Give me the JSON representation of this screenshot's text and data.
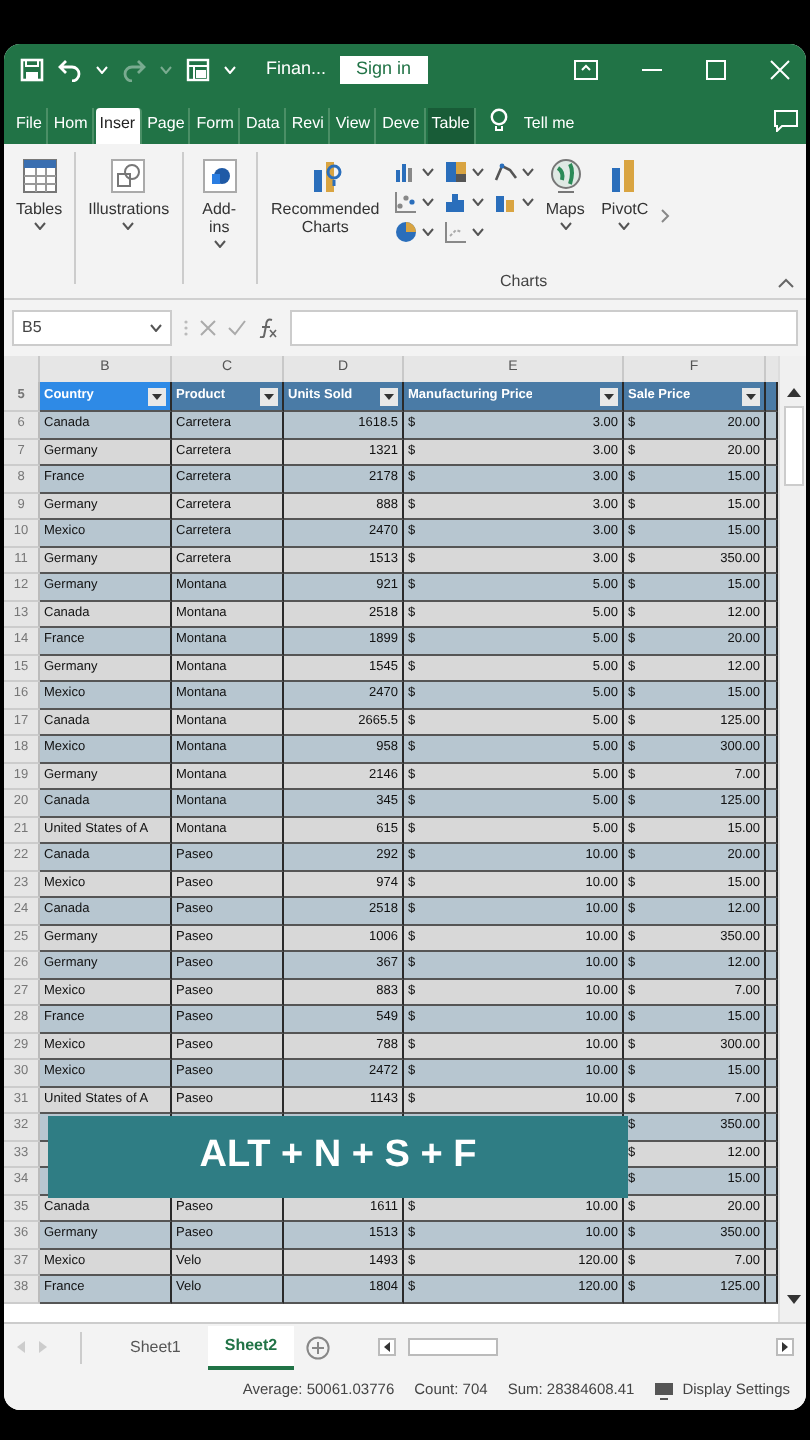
{
  "title_bar": {
    "quick_access": [
      {
        "kind": "save",
        "disabled": false
      },
      {
        "kind": "undo",
        "disabled": false
      },
      {
        "kind": "redo",
        "disabled": true
      },
      {
        "kind": "form",
        "disabled": false
      },
      {
        "kind": "customize",
        "disabled": false
      }
    ],
    "file_name": "Finan...",
    "sign_in": "Sign in"
  },
  "ribbon_tabs": [
    {
      "label": "File",
      "selected": false,
      "contextual": false
    },
    {
      "label": "Hom",
      "selected": false,
      "contextual": false
    },
    {
      "label": "Inser",
      "selected": true,
      "contextual": false
    },
    {
      "label": "Page",
      "selected": false,
      "contextual": false
    },
    {
      "label": "Form",
      "selected": false,
      "contextual": false
    },
    {
      "label": "Data",
      "selected": false,
      "contextual": false
    },
    {
      "label": "Revi",
      "selected": false,
      "contextual": false
    },
    {
      "label": "View",
      "selected": false,
      "contextual": false
    },
    {
      "label": "Deve",
      "selected": false,
      "contextual": false
    },
    {
      "label": "Table",
      "selected": false,
      "contextual": true
    }
  ],
  "tell_me": "Tell me",
  "ribbon": {
    "buttons": [
      {
        "kind": "tables",
        "label": "Tables"
      },
      {
        "kind": "illustrations",
        "label": "Illustrations"
      },
      {
        "kind": "addins",
        "label": "Add-ins"
      },
      {
        "kind": "recommended",
        "label": "Recommended Charts"
      },
      {
        "kind": "chart_grid"
      },
      {
        "kind": "maps",
        "label": "Maps"
      },
      {
        "kind": "pivot",
        "label": "PivotC"
      }
    ],
    "group_label": "Charts"
  },
  "formula_bar": {
    "name_box": "B5"
  },
  "column_letters": [
    "B",
    "C",
    "D",
    "E",
    "F"
  ],
  "header_row": "5",
  "columns": [
    {
      "header": "Country",
      "selected": true
    },
    {
      "header": "Product",
      "selected": false
    },
    {
      "header": "Units Sold",
      "selected": false
    },
    {
      "header": "Manufacturing Price",
      "selected": false
    },
    {
      "header": "Sale Price",
      "selected": false
    }
  ],
  "rows": [
    {
      "row": "6",
      "country": "Canada",
      "product": "Carretera",
      "units_sold": "1618.5",
      "mfg_currency": "$",
      "mfg_price": "3.00",
      "sale_currency": "$",
      "sale_price": "20.00"
    },
    {
      "row": "7",
      "country": "Germany",
      "product": "Carretera",
      "units_sold": "1321",
      "mfg_currency": "$",
      "mfg_price": "3.00",
      "sale_currency": "$",
      "sale_price": "20.00"
    },
    {
      "row": "8",
      "country": "France",
      "product": "Carretera",
      "units_sold": "2178",
      "mfg_currency": "$",
      "mfg_price": "3.00",
      "sale_currency": "$",
      "sale_price": "15.00"
    },
    {
      "row": "9",
      "country": "Germany",
      "product": "Carretera",
      "units_sold": "888",
      "mfg_currency": "$",
      "mfg_price": "3.00",
      "sale_currency": "$",
      "sale_price": "15.00"
    },
    {
      "row": "10",
      "country": "Mexico",
      "product": "Carretera",
      "units_sold": "2470",
      "mfg_currency": "$",
      "mfg_price": "3.00",
      "sale_currency": "$",
      "sale_price": "15.00"
    },
    {
      "row": "11",
      "country": "Germany",
      "product": "Carretera",
      "units_sold": "1513",
      "mfg_currency": "$",
      "mfg_price": "3.00",
      "sale_currency": "$",
      "sale_price": "350.00"
    },
    {
      "row": "12",
      "country": "Germany",
      "product": "Montana",
      "units_sold": "921",
      "mfg_currency": "$",
      "mfg_price": "5.00",
      "sale_currency": "$",
      "sale_price": "15.00"
    },
    {
      "row": "13",
      "country": "Canada",
      "product": "Montana",
      "units_sold": "2518",
      "mfg_currency": "$",
      "mfg_price": "5.00",
      "sale_currency": "$",
      "sale_price": "12.00"
    },
    {
      "row": "14",
      "country": "France",
      "product": "Montana",
      "units_sold": "1899",
      "mfg_currency": "$",
      "mfg_price": "5.00",
      "sale_currency": "$",
      "sale_price": "20.00"
    },
    {
      "row": "15",
      "country": "Germany",
      "product": "Montana",
      "units_sold": "1545",
      "mfg_currency": "$",
      "mfg_price": "5.00",
      "sale_currency": "$",
      "sale_price": "12.00"
    },
    {
      "row": "16",
      "country": "Mexico",
      "product": "Montana",
      "units_sold": "2470",
      "mfg_currency": "$",
      "mfg_price": "5.00",
      "sale_currency": "$",
      "sale_price": "15.00"
    },
    {
      "row": "17",
      "country": "Canada",
      "product": "Montana",
      "units_sold": "2665.5",
      "mfg_currency": "$",
      "mfg_price": "5.00",
      "sale_currency": "$",
      "sale_price": "125.00"
    },
    {
      "row": "18",
      "country": "Mexico",
      "product": "Montana",
      "units_sold": "958",
      "mfg_currency": "$",
      "mfg_price": "5.00",
      "sale_currency": "$",
      "sale_price": "300.00"
    },
    {
      "row": "19",
      "country": "Germany",
      "product": "Montana",
      "units_sold": "2146",
      "mfg_currency": "$",
      "mfg_price": "5.00",
      "sale_currency": "$",
      "sale_price": "7.00"
    },
    {
      "row": "20",
      "country": "Canada",
      "product": "Montana",
      "units_sold": "345",
      "mfg_currency": "$",
      "mfg_price": "5.00",
      "sale_currency": "$",
      "sale_price": "125.00"
    },
    {
      "row": "21",
      "country": "United States of A",
      "product": "Montana",
      "units_sold": "615",
      "mfg_currency": "$",
      "mfg_price": "5.00",
      "sale_currency": "$",
      "sale_price": "15.00"
    },
    {
      "row": "22",
      "country": "Canada",
      "product": "Paseo",
      "units_sold": "292",
      "mfg_currency": "$",
      "mfg_price": "10.00",
      "sale_currency": "$",
      "sale_price": "20.00"
    },
    {
      "row": "23",
      "country": "Mexico",
      "product": "Paseo",
      "units_sold": "974",
      "mfg_currency": "$",
      "mfg_price": "10.00",
      "sale_currency": "$",
      "sale_price": "15.00"
    },
    {
      "row": "24",
      "country": "Canada",
      "product": "Paseo",
      "units_sold": "2518",
      "mfg_currency": "$",
      "mfg_price": "10.00",
      "sale_currency": "$",
      "sale_price": "12.00"
    },
    {
      "row": "25",
      "country": "Germany",
      "product": "Paseo",
      "units_sold": "1006",
      "mfg_currency": "$",
      "mfg_price": "10.00",
      "sale_currency": "$",
      "sale_price": "350.00"
    },
    {
      "row": "26",
      "country": "Germany",
      "product": "Paseo",
      "units_sold": "367",
      "mfg_currency": "$",
      "mfg_price": "10.00",
      "sale_currency": "$",
      "sale_price": "12.00"
    },
    {
      "row": "27",
      "country": "Mexico",
      "product": "Paseo",
      "units_sold": "883",
      "mfg_currency": "$",
      "mfg_price": "10.00",
      "sale_currency": "$",
      "sale_price": "7.00"
    },
    {
      "row": "28",
      "country": "France",
      "product": "Paseo",
      "units_sold": "549",
      "mfg_currency": "$",
      "mfg_price": "10.00",
      "sale_currency": "$",
      "sale_price": "15.00"
    },
    {
      "row": "29",
      "country": "Mexico",
      "product": "Paseo",
      "units_sold": "788",
      "mfg_currency": "$",
      "mfg_price": "10.00",
      "sale_currency": "$",
      "sale_price": "300.00"
    },
    {
      "row": "30",
      "country": "Mexico",
      "product": "Paseo",
      "units_sold": "2472",
      "mfg_currency": "$",
      "mfg_price": "10.00",
      "sale_currency": "$",
      "sale_price": "15.00"
    },
    {
      "row": "31",
      "country": "United States of A",
      "product": "Paseo",
      "units_sold": "1143",
      "mfg_currency": "$",
      "mfg_price": "10.00",
      "sale_currency": "$",
      "sale_price": "7.00"
    },
    {
      "row": "32",
      "sale_currency": "$",
      "sale_price": "350.00"
    },
    {
      "row": "33",
      "sale_currency": "$",
      "sale_price": "12.00"
    },
    {
      "row": "34",
      "sale_currency": "$",
      "sale_price": "15.00"
    },
    {
      "row": "35",
      "country": "Canada",
      "product": "Paseo",
      "units_sold": "1611",
      "mfg_currency": "$",
      "mfg_price": "10.00",
      "sale_currency": "$",
      "sale_price": "20.00"
    },
    {
      "row": "36",
      "country": "Germany",
      "product": "Paseo",
      "units_sold": "1513",
      "mfg_currency": "$",
      "mfg_price": "10.00",
      "sale_currency": "$",
      "sale_price": "350.00"
    },
    {
      "row": "37",
      "country": "Mexico",
      "product": "Velo",
      "units_sold": "1493",
      "mfg_currency": "$",
      "mfg_price": "120.00",
      "sale_currency": "$",
      "sale_price": "7.00"
    },
    {
      "row": "38",
      "country": "France",
      "product": "Velo",
      "units_sold": "1804",
      "mfg_currency": "$",
      "mfg_price": "120.00",
      "sale_currency": "$",
      "sale_price": "125.00"
    }
  ],
  "banner": {
    "text": "ALT + N + S + F"
  },
  "sheets": [
    {
      "label": "Sheet1",
      "selected": false
    },
    {
      "label": "Sheet2",
      "selected": true
    }
  ],
  "status_bar": {
    "average": "Average: 50061.03776",
    "count": "Count: 704",
    "sum": "Sum: 28384608.41",
    "display_settings": "Display Settings"
  }
}
